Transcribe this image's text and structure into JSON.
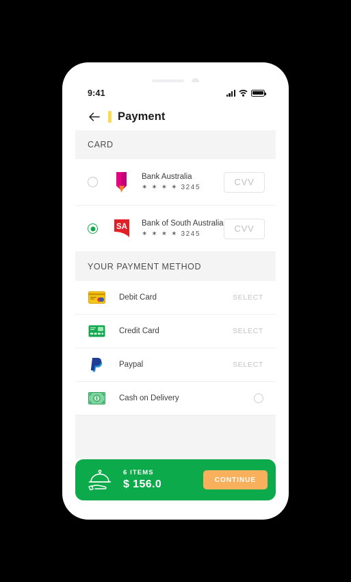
{
  "status_bar": {
    "time": "9:41",
    "signal_icon": "signal-bars-icon",
    "wifi_icon": "wifi-icon",
    "battery_icon": "battery-full-icon"
  },
  "app_bar": {
    "back_icon": "back-arrow-icon",
    "title": "Payment",
    "accent_color": "#fbdb54"
  },
  "card_section": {
    "header": "CARD",
    "cards": [
      {
        "name": "Bank Australia",
        "masked": "✶ ✶ ✶ ✶",
        "digits": "3245",
        "selected": false,
        "logo": "bank-australia-logo",
        "cvv_placeholder": "CVV"
      },
      {
        "name": "Bank of South Australia",
        "masked": "✶ ✶ ✶ ✶",
        "digits": "3245",
        "selected": true,
        "logo": "bank-of-south-australia-logo",
        "cvv_placeholder": "CVV"
      }
    ]
  },
  "method_section": {
    "header": "YOUR PAYMENT METHOD",
    "methods": [
      {
        "label": "Debit Card",
        "action": "SELECT",
        "icon": "debit-card-icon",
        "control": "link"
      },
      {
        "label": "Credit Card",
        "action": "SELECT",
        "icon": "credit-card-icon",
        "control": "link"
      },
      {
        "label": "Paypal",
        "action": "SELECT",
        "icon": "paypal-icon",
        "control": "link"
      },
      {
        "label": "Cash on Delivery",
        "action": "",
        "icon": "cash-on-delivery-icon",
        "control": "radio"
      }
    ]
  },
  "cart_bar": {
    "items_label": "6 ITEMS",
    "total": "$ 156.0",
    "button_label": "CONTINUE",
    "cart_icon": "room-service-tray-icon",
    "bar_color": "#0caa4a",
    "button_color": "#f8b05c"
  }
}
